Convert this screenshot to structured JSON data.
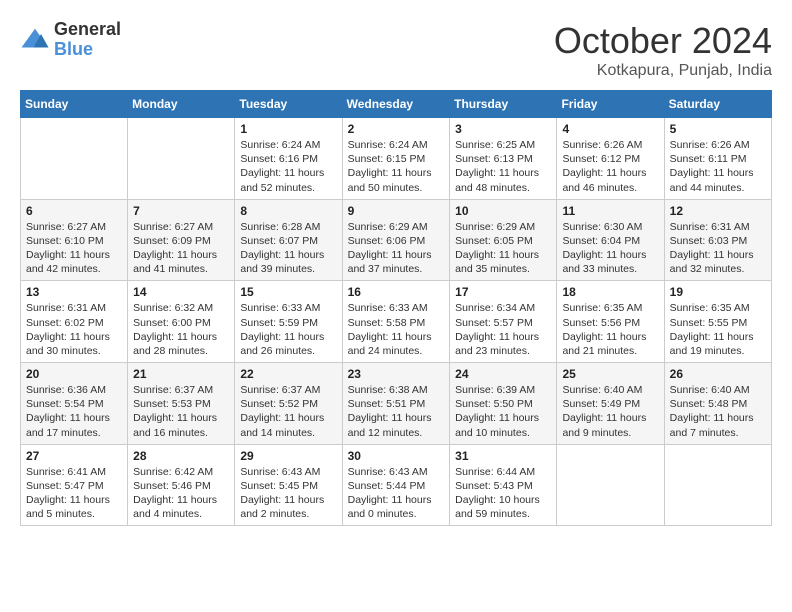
{
  "logo": {
    "general": "General",
    "blue": "Blue"
  },
  "title": "October 2024",
  "location": "Kotkapura, Punjab, India",
  "days_of_week": [
    "Sunday",
    "Monday",
    "Tuesday",
    "Wednesday",
    "Thursday",
    "Friday",
    "Saturday"
  ],
  "weeks": [
    [
      {
        "day": "",
        "sunrise": "",
        "sunset": "",
        "daylight": ""
      },
      {
        "day": "",
        "sunrise": "",
        "sunset": "",
        "daylight": ""
      },
      {
        "day": "1",
        "sunrise": "Sunrise: 6:24 AM",
        "sunset": "Sunset: 6:16 PM",
        "daylight": "Daylight: 11 hours and 52 minutes."
      },
      {
        "day": "2",
        "sunrise": "Sunrise: 6:24 AM",
        "sunset": "Sunset: 6:15 PM",
        "daylight": "Daylight: 11 hours and 50 minutes."
      },
      {
        "day": "3",
        "sunrise": "Sunrise: 6:25 AM",
        "sunset": "Sunset: 6:13 PM",
        "daylight": "Daylight: 11 hours and 48 minutes."
      },
      {
        "day": "4",
        "sunrise": "Sunrise: 6:26 AM",
        "sunset": "Sunset: 6:12 PM",
        "daylight": "Daylight: 11 hours and 46 minutes."
      },
      {
        "day": "5",
        "sunrise": "Sunrise: 6:26 AM",
        "sunset": "Sunset: 6:11 PM",
        "daylight": "Daylight: 11 hours and 44 minutes."
      }
    ],
    [
      {
        "day": "6",
        "sunrise": "Sunrise: 6:27 AM",
        "sunset": "Sunset: 6:10 PM",
        "daylight": "Daylight: 11 hours and 42 minutes."
      },
      {
        "day": "7",
        "sunrise": "Sunrise: 6:27 AM",
        "sunset": "Sunset: 6:09 PM",
        "daylight": "Daylight: 11 hours and 41 minutes."
      },
      {
        "day": "8",
        "sunrise": "Sunrise: 6:28 AM",
        "sunset": "Sunset: 6:07 PM",
        "daylight": "Daylight: 11 hours and 39 minutes."
      },
      {
        "day": "9",
        "sunrise": "Sunrise: 6:29 AM",
        "sunset": "Sunset: 6:06 PM",
        "daylight": "Daylight: 11 hours and 37 minutes."
      },
      {
        "day": "10",
        "sunrise": "Sunrise: 6:29 AM",
        "sunset": "Sunset: 6:05 PM",
        "daylight": "Daylight: 11 hours and 35 minutes."
      },
      {
        "day": "11",
        "sunrise": "Sunrise: 6:30 AM",
        "sunset": "Sunset: 6:04 PM",
        "daylight": "Daylight: 11 hours and 33 minutes."
      },
      {
        "day": "12",
        "sunrise": "Sunrise: 6:31 AM",
        "sunset": "Sunset: 6:03 PM",
        "daylight": "Daylight: 11 hours and 32 minutes."
      }
    ],
    [
      {
        "day": "13",
        "sunrise": "Sunrise: 6:31 AM",
        "sunset": "Sunset: 6:02 PM",
        "daylight": "Daylight: 11 hours and 30 minutes."
      },
      {
        "day": "14",
        "sunrise": "Sunrise: 6:32 AM",
        "sunset": "Sunset: 6:00 PM",
        "daylight": "Daylight: 11 hours and 28 minutes."
      },
      {
        "day": "15",
        "sunrise": "Sunrise: 6:33 AM",
        "sunset": "Sunset: 5:59 PM",
        "daylight": "Daylight: 11 hours and 26 minutes."
      },
      {
        "day": "16",
        "sunrise": "Sunrise: 6:33 AM",
        "sunset": "Sunset: 5:58 PM",
        "daylight": "Daylight: 11 hours and 24 minutes."
      },
      {
        "day": "17",
        "sunrise": "Sunrise: 6:34 AM",
        "sunset": "Sunset: 5:57 PM",
        "daylight": "Daylight: 11 hours and 23 minutes."
      },
      {
        "day": "18",
        "sunrise": "Sunrise: 6:35 AM",
        "sunset": "Sunset: 5:56 PM",
        "daylight": "Daylight: 11 hours and 21 minutes."
      },
      {
        "day": "19",
        "sunrise": "Sunrise: 6:35 AM",
        "sunset": "Sunset: 5:55 PM",
        "daylight": "Daylight: 11 hours and 19 minutes."
      }
    ],
    [
      {
        "day": "20",
        "sunrise": "Sunrise: 6:36 AM",
        "sunset": "Sunset: 5:54 PM",
        "daylight": "Daylight: 11 hours and 17 minutes."
      },
      {
        "day": "21",
        "sunrise": "Sunrise: 6:37 AM",
        "sunset": "Sunset: 5:53 PM",
        "daylight": "Daylight: 11 hours and 16 minutes."
      },
      {
        "day": "22",
        "sunrise": "Sunrise: 6:37 AM",
        "sunset": "Sunset: 5:52 PM",
        "daylight": "Daylight: 11 hours and 14 minutes."
      },
      {
        "day": "23",
        "sunrise": "Sunrise: 6:38 AM",
        "sunset": "Sunset: 5:51 PM",
        "daylight": "Daylight: 11 hours and 12 minutes."
      },
      {
        "day": "24",
        "sunrise": "Sunrise: 6:39 AM",
        "sunset": "Sunset: 5:50 PM",
        "daylight": "Daylight: 11 hours and 10 minutes."
      },
      {
        "day": "25",
        "sunrise": "Sunrise: 6:40 AM",
        "sunset": "Sunset: 5:49 PM",
        "daylight": "Daylight: 11 hours and 9 minutes."
      },
      {
        "day": "26",
        "sunrise": "Sunrise: 6:40 AM",
        "sunset": "Sunset: 5:48 PM",
        "daylight": "Daylight: 11 hours and 7 minutes."
      }
    ],
    [
      {
        "day": "27",
        "sunrise": "Sunrise: 6:41 AM",
        "sunset": "Sunset: 5:47 PM",
        "daylight": "Daylight: 11 hours and 5 minutes."
      },
      {
        "day": "28",
        "sunrise": "Sunrise: 6:42 AM",
        "sunset": "Sunset: 5:46 PM",
        "daylight": "Daylight: 11 hours and 4 minutes."
      },
      {
        "day": "29",
        "sunrise": "Sunrise: 6:43 AM",
        "sunset": "Sunset: 5:45 PM",
        "daylight": "Daylight: 11 hours and 2 minutes."
      },
      {
        "day": "30",
        "sunrise": "Sunrise: 6:43 AM",
        "sunset": "Sunset: 5:44 PM",
        "daylight": "Daylight: 11 hours and 0 minutes."
      },
      {
        "day": "31",
        "sunrise": "Sunrise: 6:44 AM",
        "sunset": "Sunset: 5:43 PM",
        "daylight": "Daylight: 10 hours and 59 minutes."
      },
      {
        "day": "",
        "sunrise": "",
        "sunset": "",
        "daylight": ""
      },
      {
        "day": "",
        "sunrise": "",
        "sunset": "",
        "daylight": ""
      }
    ]
  ]
}
